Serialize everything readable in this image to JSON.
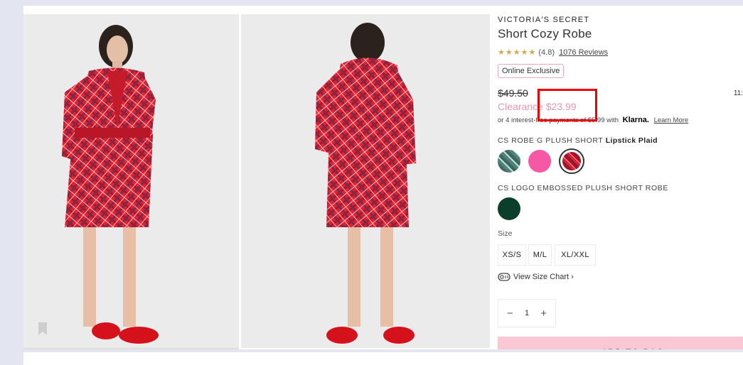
{
  "product": {
    "brand": "VICTORIA'S SECRET",
    "name": "Short Cozy Robe",
    "stars": "★★★★★",
    "rating": "(4.8)",
    "reviews": "1076 Reviews",
    "badge": "Online Exclusive",
    "original_price": "$49.50",
    "sale_label": "Clearance $23.99",
    "right_edge_text": "11:",
    "klarna_prefix": "or 4 interest-free payments of $5.99 with",
    "klarna_brand": "Klarna.",
    "learn_more": "Learn More"
  },
  "colors": {
    "group1_label": "CS ROBE G PLUSH SHORT",
    "group1_selected": "Lipstick Plaid",
    "group2_label": "CS LOGO EMBOSSED PLUSH SHORT ROBE"
  },
  "size": {
    "label": "Size",
    "options": [
      "XS/S",
      "M/L",
      "XL/XXL"
    ],
    "chart_link": "View Size Chart ›"
  },
  "quantity": {
    "minus": "−",
    "value": "1",
    "plus": "+"
  },
  "cta": {
    "add_to_bag": "ADD TO BAG"
  },
  "accent": {
    "highlight_border": "#f20000",
    "clearance_pink": "#e895b6",
    "cta_bg": "#f9c8d4"
  }
}
